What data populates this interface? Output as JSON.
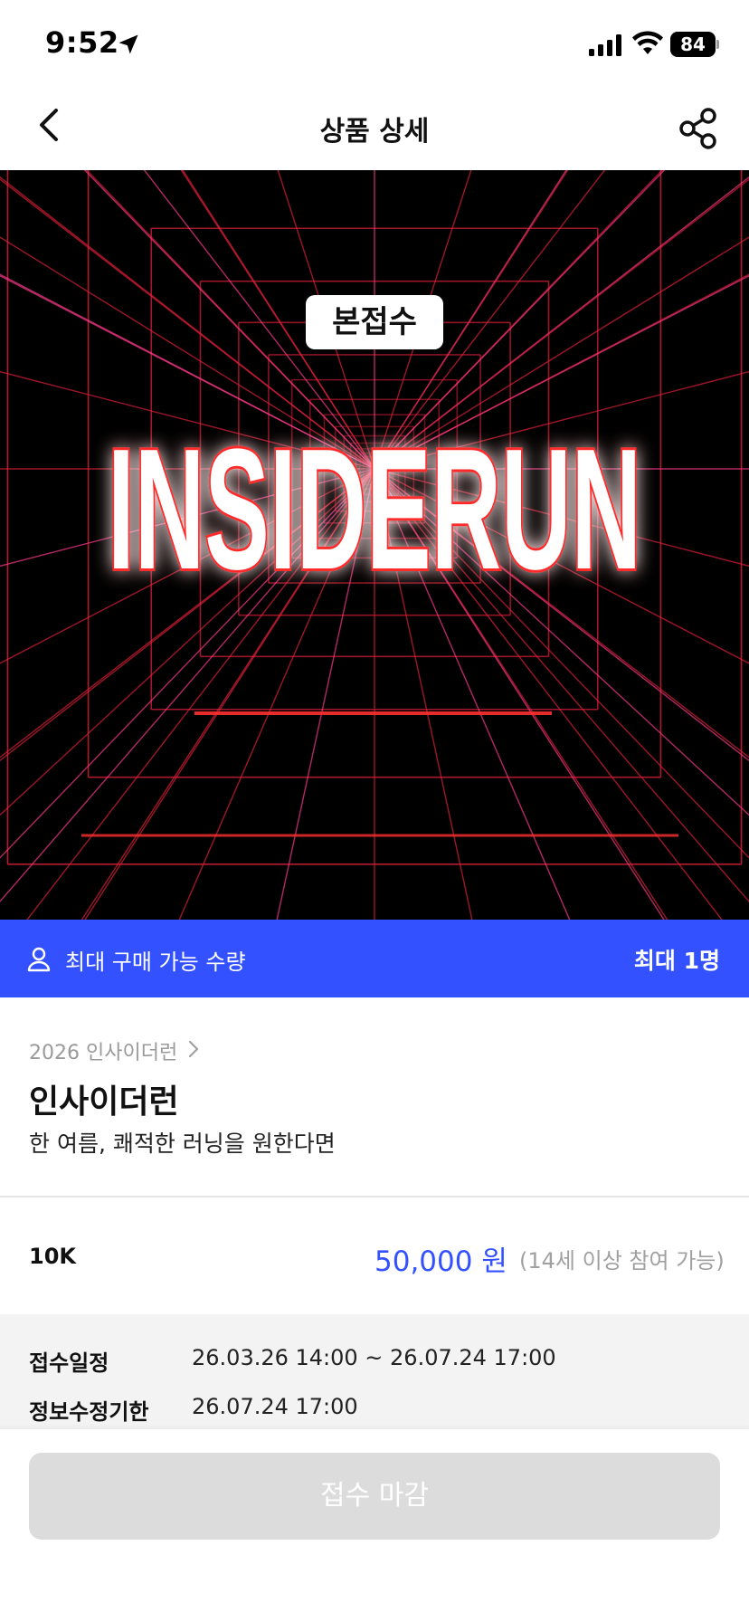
{
  "status_bar": {
    "time": "9:52",
    "battery": "84"
  },
  "nav": {
    "title": "상품 상세"
  },
  "hero": {
    "badge": "본접수",
    "logo_text": "INSIDERUN",
    "colors": {
      "background": "#000000",
      "grid": "#e0203a",
      "accent": "#ff3a8c"
    }
  },
  "limit_bar": {
    "label": "최대 구매 가능 수량",
    "value": "최대 1명",
    "color": "#3451ff"
  },
  "product": {
    "breadcrumb": "2026 인사이더런",
    "title": "인사이더런",
    "subtitle": "한 여름, 쾌적한 러닝을 원한다면"
  },
  "option": {
    "name": "10K",
    "price": "50,000 원",
    "note": "(14세 이상 참여 가능)"
  },
  "schedule": [
    {
      "label": "접수일정",
      "value": "26.03.26 14:00 ~ 26.07.24 17:00"
    },
    {
      "label": "정보수정기한",
      "value": "26.07.24 17:00"
    }
  ],
  "footer": {
    "button_label": "접수 마감"
  }
}
